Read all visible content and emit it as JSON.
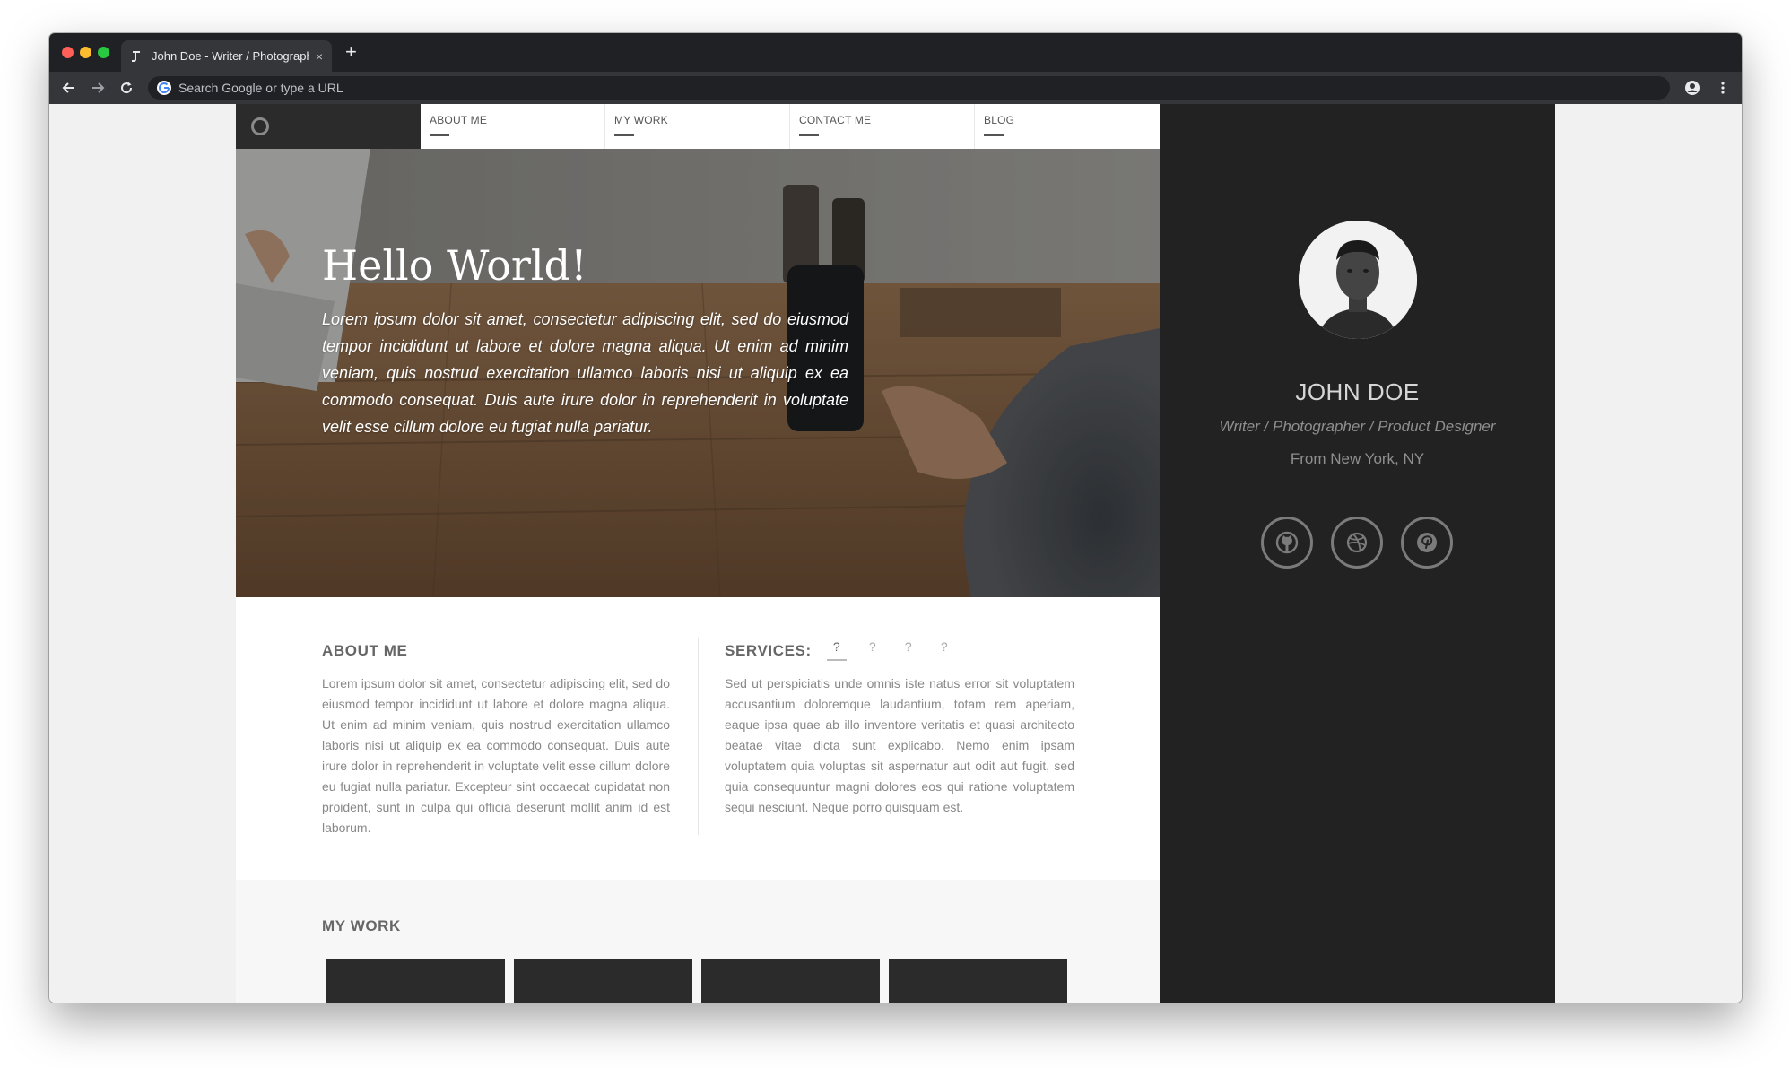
{
  "browser": {
    "tab_title": "John Doe - Writer / Photograph",
    "omnibox_placeholder": "Search Google or type a URL",
    "new_tab_symbol": "+",
    "close_symbol": "×"
  },
  "nav": {
    "items": [
      {
        "label": "ABOUT ME"
      },
      {
        "label": "MY WORK"
      },
      {
        "label": "CONTACT ME"
      },
      {
        "label": "BLOG"
      }
    ]
  },
  "hero": {
    "title": "Hello World!",
    "text": "Lorem ipsum dolor sit amet, consectetur adipiscing elit, sed do eiusmod tempor incididunt ut labore et dolore magna aliqua. Ut enim ad minim veniam, quis nostrud exercitation ullamco laboris nisi ut aliquip ex ea commodo consequat. Duis aute irure dolor in reprehenderit in voluptate velit esse cillum dolore eu fugiat nulla pariatur."
  },
  "about": {
    "heading": "ABOUT ME",
    "text": "Lorem ipsum dolor sit amet, consectetur adipiscing elit, sed do eiusmod tempor incididunt ut labore et dolore magna aliqua. Ut enim ad minim veniam, quis nostrud exercitation ullamco laboris nisi ut aliquip ex ea commodo consequat. Duis aute irure dolor in reprehenderit in voluptate velit esse cillum dolore eu fugiat nulla pariatur. Excepteur sint occaecat cupidatat non proident, sunt in culpa qui officia deserunt mollit anim id est laborum."
  },
  "services": {
    "heading": "SERVICES:",
    "tabs": [
      "?",
      "?",
      "?",
      "?"
    ],
    "text": "Sed ut perspiciatis unde omnis iste natus error sit voluptatem accusantium doloremque laudantium, totam rem aperiam, eaque ipsa quae ab illo inventore veritatis et quasi architecto beatae vitae dicta sunt explicabo. Nemo enim ipsam voluptatem quia voluptas sit aspernatur aut odit aut fugit, sed quia consequuntur magni dolores eos qui ratione voluptatem sequi nesciunt. Neque porro quisquam est."
  },
  "work": {
    "heading": "MY WORK"
  },
  "profile": {
    "name": "JOHN DOE",
    "role": "Writer / Photographer / Product Designer",
    "location": "From New York, NY",
    "social": [
      "github-icon",
      "dribbble-icon",
      "pinterest-icon"
    ]
  },
  "colors": {
    "sidebar_bg": "#222222",
    "nav_logo_bg": "#2b2b2b",
    "browser_chrome": "#202124"
  }
}
